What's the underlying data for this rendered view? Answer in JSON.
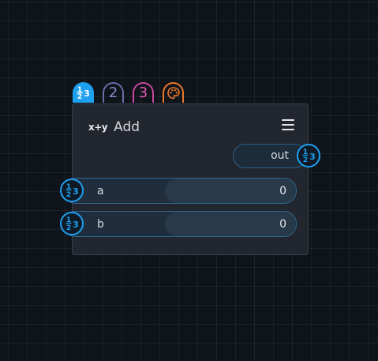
{
  "tabs": [
    {
      "id": "number",
      "icon": "number-type-icon",
      "active": true
    },
    {
      "id": "2",
      "label": "2"
    },
    {
      "id": "3",
      "label": "3"
    },
    {
      "id": "palette",
      "icon": "palette-icon"
    }
  ],
  "node": {
    "func_icon": "x+y",
    "title": "Add",
    "menu_icon": "hamburger-menu-icon",
    "output": {
      "label": "out",
      "socket_icon": "number-type-icon"
    },
    "inputs": [
      {
        "label": "a",
        "value": "0",
        "socket_icon": "number-type-icon"
      },
      {
        "label": "b",
        "value": "0",
        "socket_icon": "number-type-icon"
      }
    ]
  },
  "colors": {
    "accent": "#1ea0f0",
    "tab_2": "#8887c7",
    "tab_3": "#e05bb2",
    "tab_palette": "#e9782a",
    "background": "#0f131a",
    "node_bg": "#22262e"
  }
}
